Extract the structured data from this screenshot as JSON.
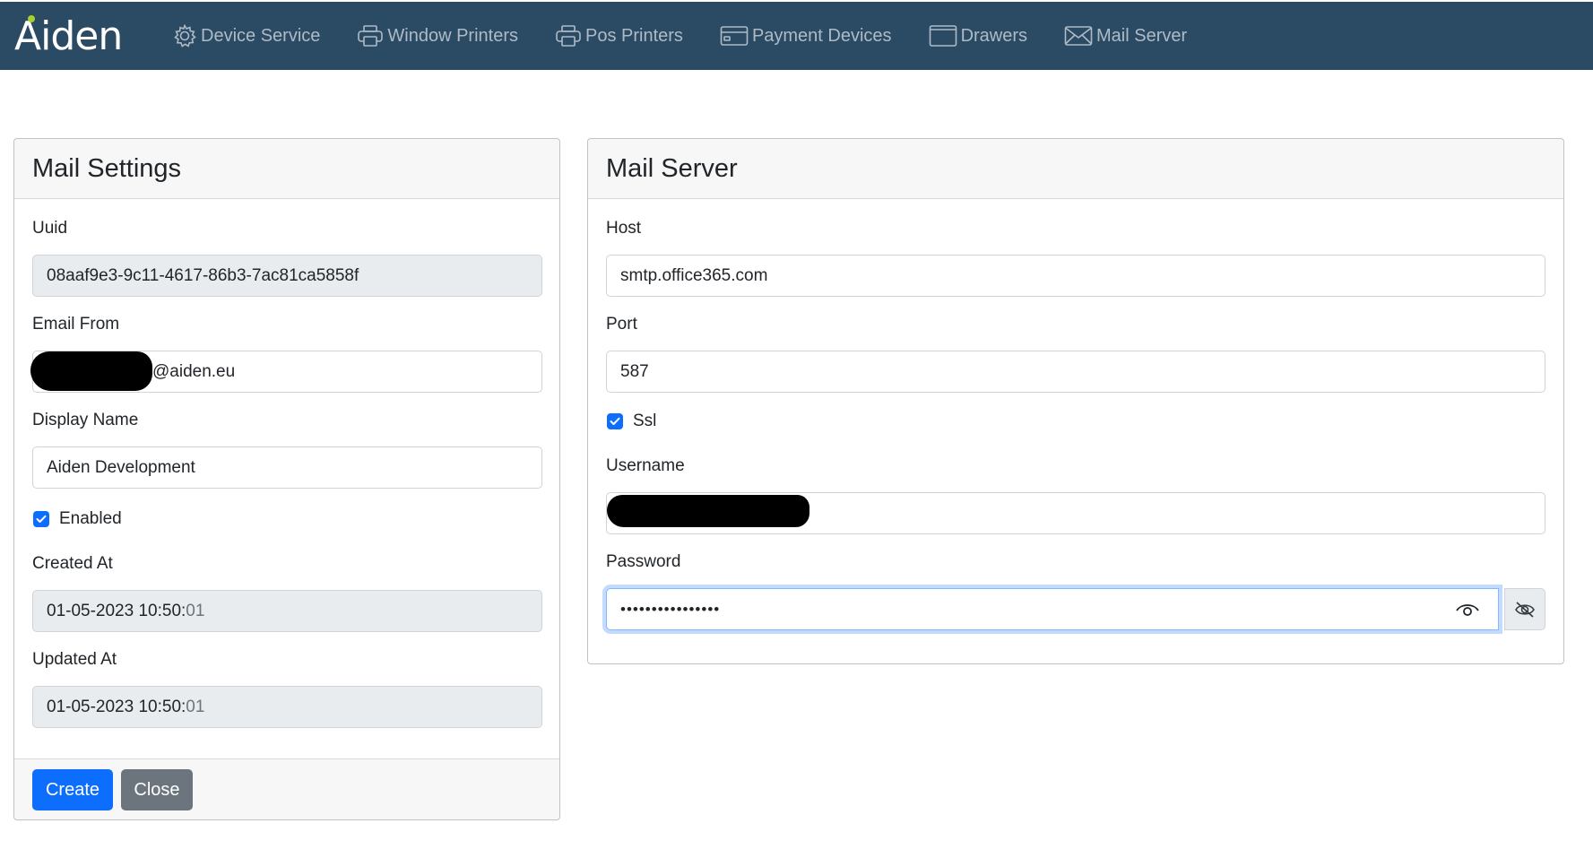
{
  "brand": {
    "name": "Aiden"
  },
  "nav": [
    {
      "label": "Device Service",
      "icon": "gear-icon"
    },
    {
      "label": "Window Printers",
      "icon": "printer-icon"
    },
    {
      "label": "Pos Printers",
      "icon": "printer-icon"
    },
    {
      "label": "Payment Devices",
      "icon": "credit-card-icon"
    },
    {
      "label": "Drawers",
      "icon": "window-icon"
    },
    {
      "label": "Mail Server",
      "icon": "envelope-icon"
    }
  ],
  "mail_settings": {
    "title": "Mail Settings",
    "uuid_label": "Uuid",
    "uuid_value": "08aaf9e3-9c11-4617-86b3-7ac81ca5858f",
    "email_from_label": "Email From",
    "email_from_value": "@aiden.eu",
    "display_name_label": "Display Name",
    "display_name_value": "Aiden Development",
    "enabled_label": "Enabled",
    "enabled": true,
    "created_at_label": "Created At",
    "created_at_main": "01-05-2023 10:50:",
    "created_at_seconds": "01",
    "updated_at_label": "Updated At",
    "updated_at_main": "01-05-2023 10:50:",
    "updated_at_seconds": "01",
    "create_button": "Create",
    "close_button": "Close"
  },
  "mail_server": {
    "title": "Mail Server",
    "host_label": "Host",
    "host_value": "smtp.office365.com",
    "port_label": "Port",
    "port_value": "587",
    "ssl_label": "Ssl",
    "ssl": true,
    "username_label": "Username",
    "password_label": "Password",
    "password_value": "••••••••••••••••"
  },
  "colors": {
    "navbar": "#2b4a63",
    "primary": "#0d6efd",
    "secondary": "#6c757d",
    "brand_dot": "#a7d129"
  }
}
